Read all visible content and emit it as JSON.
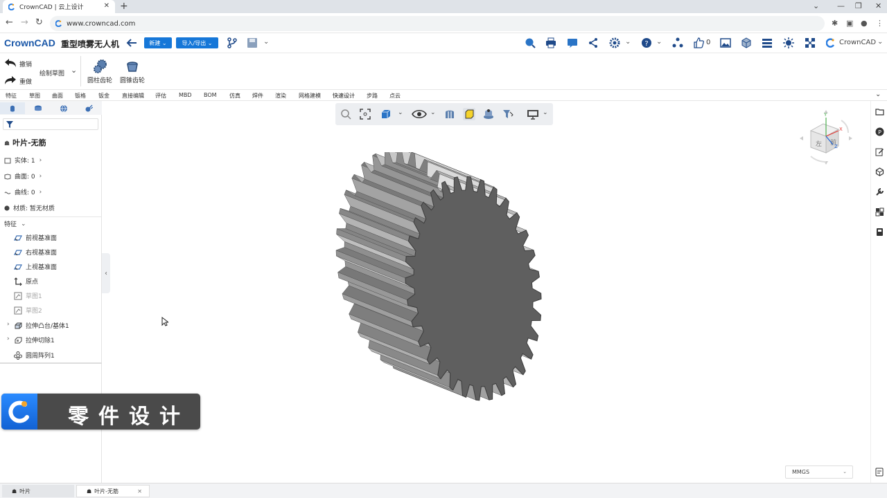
{
  "browser": {
    "tab_title": "CrownCAD | 云上设计",
    "url": "www.crowncad.com"
  },
  "app": {
    "logo_text": "CrownCAD",
    "document_title": "重型喷雾无人机",
    "new_button": "新建",
    "import_export_button": "导入/导出",
    "like_count": "0",
    "user_name": "CrownCAD"
  },
  "ribbon": {
    "undo": "撤销",
    "redo": "重做",
    "draw_sketch": "绘制草图",
    "cylindrical_gear": "圆柱齿轮",
    "bevel_gear": "圆锥齿轮"
  },
  "menu": [
    "特征",
    "草图",
    "曲面",
    "钣格",
    "钣金",
    "直接编辑",
    "评估",
    "MBD",
    "BOM",
    "仿真",
    "焊件",
    "渲染",
    "网格建模",
    "快速设计",
    "步路",
    "点云"
  ],
  "sidebar": {
    "part_name": "叶片-无筋",
    "solid": "实体: 1",
    "surface": "曲面: 0",
    "curve": "曲线: 0",
    "material": "材质:  暂无材质",
    "features_header": "特征",
    "tree": [
      {
        "label": "前视基准面",
        "icon": "plane-icon",
        "dim": false
      },
      {
        "label": "右视基准面",
        "icon": "plane-icon",
        "dim": false
      },
      {
        "label": "上视基准面",
        "icon": "plane-icon",
        "dim": false
      },
      {
        "label": "原点",
        "icon": "origin-icon",
        "dim": false
      },
      {
        "label": "草图1",
        "icon": "sketch-icon",
        "dim": true
      },
      {
        "label": "草图2",
        "icon": "sketch-icon",
        "dim": true
      },
      {
        "label": "拉伸凸台/基体1",
        "icon": "extrude-boss-icon",
        "dim": false
      },
      {
        "label": "拉伸切除1",
        "icon": "extrude-cut-icon",
        "dim": false
      },
      {
        "label": "圆周阵列1",
        "icon": "circular-pattern-icon",
        "dim": false
      }
    ]
  },
  "banner": {
    "text": "零件设计"
  },
  "units": {
    "value": "MMGS"
  },
  "bottom_tabs": [
    {
      "label": "叶片"
    },
    {
      "label": "叶片-无筋"
    }
  ],
  "colors": {
    "accent": "#1677d8",
    "brand": "#1a57a8",
    "gear": "#8a8a8a"
  }
}
